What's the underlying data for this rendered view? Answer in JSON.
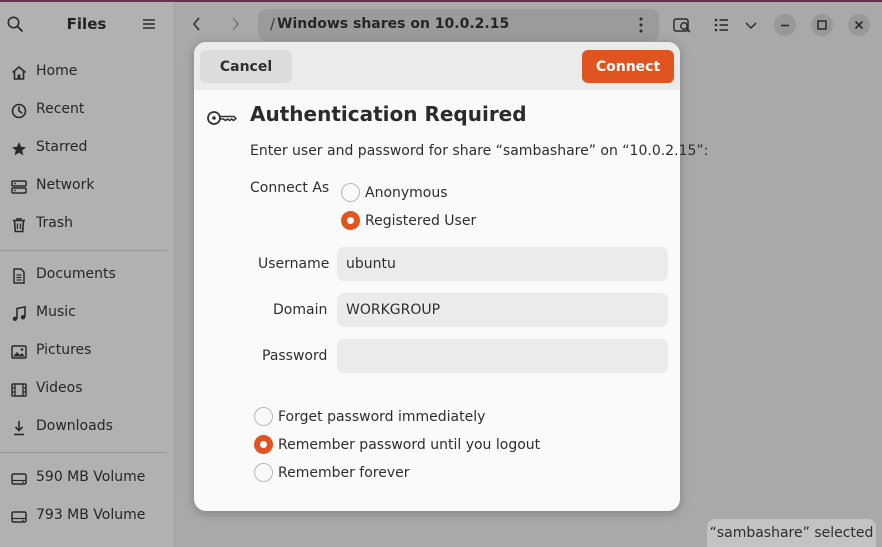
{
  "sidebar": {
    "title": "Files",
    "places": [
      {
        "label": "Home",
        "icon": "home-icon"
      },
      {
        "label": "Recent",
        "icon": "clock-icon"
      },
      {
        "label": "Starred",
        "icon": "star-icon"
      },
      {
        "label": "Network",
        "icon": "network-icon"
      },
      {
        "label": "Trash",
        "icon": "trash-icon"
      }
    ],
    "bookmarks": [
      {
        "label": "Documents",
        "icon": "document-icon"
      },
      {
        "label": "Music",
        "icon": "music-icon"
      },
      {
        "label": "Pictures",
        "icon": "picture-icon"
      },
      {
        "label": "Videos",
        "icon": "video-icon"
      },
      {
        "label": "Downloads",
        "icon": "download-icon"
      }
    ],
    "volumes": [
      {
        "label": "590 MB Volume",
        "icon": "drive-icon"
      },
      {
        "label": "793 MB Volume",
        "icon": "drive-icon"
      }
    ]
  },
  "header": {
    "path_title": "Windows shares on 10.0.2.15"
  },
  "status": {
    "text": "“sambashare” selected"
  },
  "dialog": {
    "cancel_label": "Cancel",
    "connect_label": "Connect",
    "title": "Authentication Required",
    "message": "Enter user and password for share “sambashare” on “10.0.2.15”:",
    "connect_as_label": "Connect As",
    "connect_as_options": [
      {
        "label": "Anonymous",
        "selected": false
      },
      {
        "label": "Registered User",
        "selected": true
      }
    ],
    "username_label": "Username",
    "username_value": "ubuntu",
    "domain_label": "Domain",
    "domain_value": "WORKGROUP",
    "password_label": "Password",
    "password_value": "",
    "remember_options": [
      {
        "label": "Forget password immediately",
        "selected": false
      },
      {
        "label": "Remember password until you logout",
        "selected": true
      },
      {
        "label": "Remember forever",
        "selected": false
      }
    ]
  },
  "colors": {
    "accent": "#e0541f"
  }
}
